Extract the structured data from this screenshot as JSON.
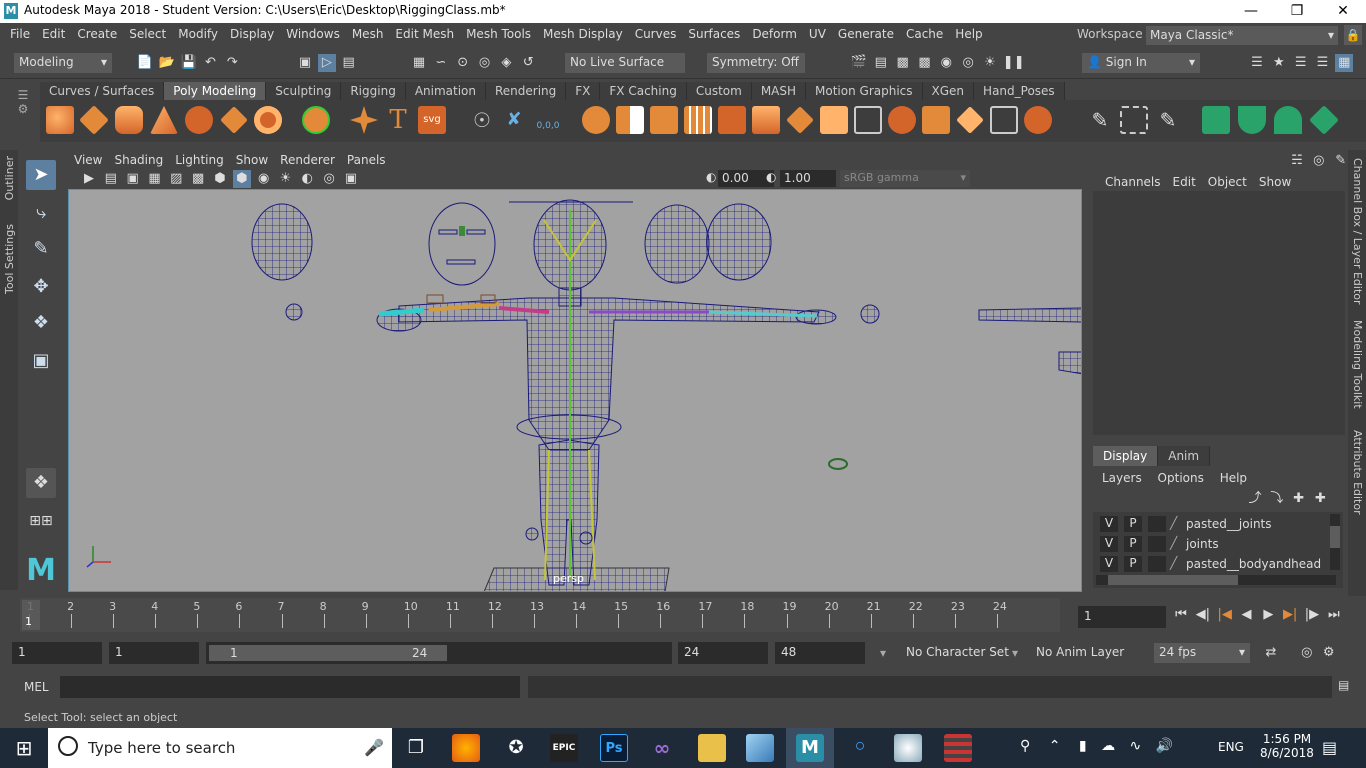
{
  "window": {
    "title": "Autodesk Maya 2018 - Student Version: C:\\Users\\Eric\\Desktop\\RiggingClass.mb*",
    "logo": "M"
  },
  "menubar": {
    "items": [
      "File",
      "Edit",
      "Create",
      "Select",
      "Modify",
      "Display",
      "Windows",
      "Mesh",
      "Edit Mesh",
      "Mesh Tools",
      "Mesh Display",
      "Curves",
      "Surfaces",
      "Deform",
      "UV",
      "Generate",
      "Cache",
      "Help"
    ],
    "workspace_label": "Workspace :",
    "workspace_value": "Maya Classic*"
  },
  "statusline": {
    "mode": "Modeling",
    "live_surface": "No Live Surface",
    "symmetry": "Symmetry: Off",
    "sign_in": "Sign In"
  },
  "shelf": {
    "tabs": [
      "Curves / Surfaces",
      "Poly Modeling",
      "Sculpting",
      "Rigging",
      "Animation",
      "Rendering",
      "FX",
      "FX Caching",
      "Custom",
      "MASH",
      "Motion Graphics",
      "XGen",
      "Hand_Poses"
    ],
    "active_tab": "Poly Modeling",
    "svg_label": "svg",
    "t_label": "T",
    "coord_label": "0,0,0"
  },
  "sidebar": {
    "outliner": "Outliner",
    "tool_settings": "Tool Settings"
  },
  "panel": {
    "menus": [
      "View",
      "Shading",
      "Lighting",
      "Show",
      "Renderer",
      "Panels"
    ],
    "exposure": "0.00",
    "gamma": "1.00",
    "colorspace": "sRGB gamma"
  },
  "viewport": {
    "camera_label": "persp"
  },
  "channelbox": {
    "menus": [
      "Channels",
      "Edit",
      "Object",
      "Show"
    ],
    "vertical_tabs": [
      "Channel Box / Layer Editor",
      "Modeling Toolkit",
      "Attribute Editor"
    ]
  },
  "layereditor": {
    "tabs": [
      "Display",
      "Anim"
    ],
    "active_tab": "Display",
    "menus": [
      "Layers",
      "Options",
      "Help"
    ],
    "layers": [
      {
        "v": "V",
        "p": "P",
        "name": "pasted__joints"
      },
      {
        "v": "V",
        "p": "P",
        "name": "joints"
      },
      {
        "v": "V",
        "p": "P",
        "name": "pasted__bodyandhead"
      }
    ]
  },
  "timeline": {
    "ticks": [
      "1",
      "2",
      "3",
      "4",
      "5",
      "6",
      "7",
      "8",
      "9",
      "10",
      "11",
      "12",
      "13",
      "14",
      "15",
      "16",
      "17",
      "18",
      "19",
      "20",
      "21",
      "22",
      "23",
      "24"
    ],
    "current_frame": "1",
    "current_frame_field": "1"
  },
  "range": {
    "start": "1",
    "playback_start": "1",
    "slider_start": "1",
    "slider_end": "24",
    "playback_end": "24",
    "end": "48",
    "character_set": "No Character Set",
    "anim_layer": "No Anim Layer",
    "fps": "24 fps"
  },
  "mel": {
    "label": "MEL"
  },
  "helpline": {
    "text": "Select Tool: select an object"
  },
  "taskbar": {
    "search_placeholder": "Type here to search",
    "epic_label": "EPIC",
    "ps_label": "Ps",
    "maya_label": "M",
    "language": "ENG",
    "time": "1:56 PM",
    "date": "8/6/2018"
  }
}
